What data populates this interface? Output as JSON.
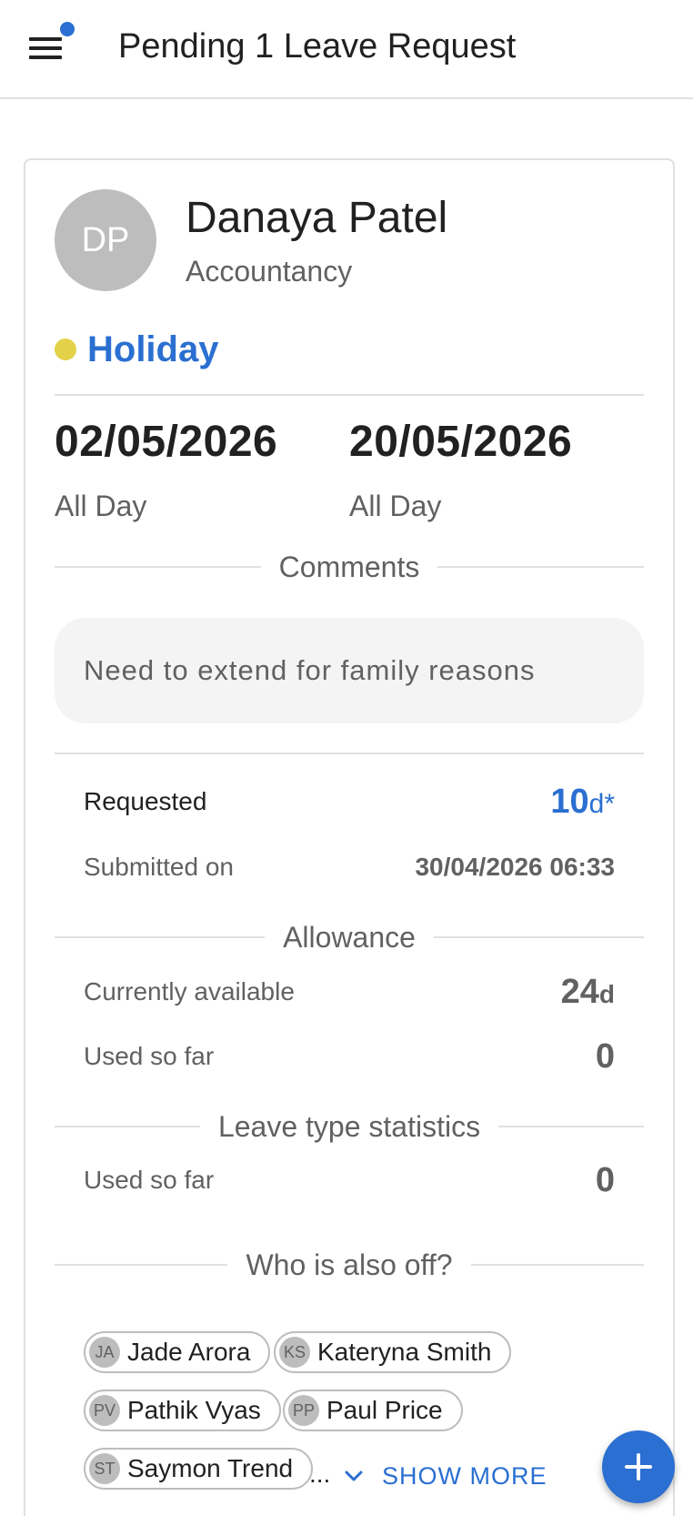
{
  "header": {
    "title": "Pending 1 Leave Request",
    "menu_icon": "hamburger-menu-icon",
    "notification_dot_color": "#2a6fd1"
  },
  "request": {
    "employee": {
      "initials": "DP",
      "name": "Danaya Patel",
      "department": "Accountancy"
    },
    "leave_type": {
      "label": "Holiday",
      "color": "#e3d249"
    },
    "start": {
      "date": "02/05/2026",
      "period": "All Day"
    },
    "end": {
      "date": "20/05/2026",
      "period": "All Day"
    },
    "comments_heading": "Comments",
    "comment": "Need to extend for family reasons",
    "requested_label": "Requested",
    "requested_value": "10",
    "requested_unit": "d*",
    "submitted_label": "Submitted on",
    "submitted_value": "30/04/2026 06:33"
  },
  "allowance": {
    "heading": "Allowance",
    "currently_available_label": "Currently available",
    "currently_available_value": "24",
    "currently_available_unit": "d",
    "used_label": "Used so far",
    "used_value": "0"
  },
  "leave_stats": {
    "heading": "Leave type statistics",
    "used_label": "Used so far",
    "used_value": "0"
  },
  "also_off": {
    "heading": "Who is also off?",
    "people": [
      {
        "initials": "JA",
        "name": "Jade Arora"
      },
      {
        "initials": "KS",
        "name": "Kateryna Smith"
      },
      {
        "initials": "PV",
        "name": "Pathik Vyas"
      },
      {
        "initials": "PP",
        "name": "Paul Price"
      },
      {
        "initials": "ST",
        "name": "Saymon Trend"
      }
    ],
    "ellipsis": "...",
    "show_more_label": "SHOW MORE"
  },
  "fab": {
    "icon": "plus-icon"
  },
  "colors": {
    "accent": "#2a6fd1",
    "border": "#e0e0e0",
    "muted_text": "#616161"
  }
}
